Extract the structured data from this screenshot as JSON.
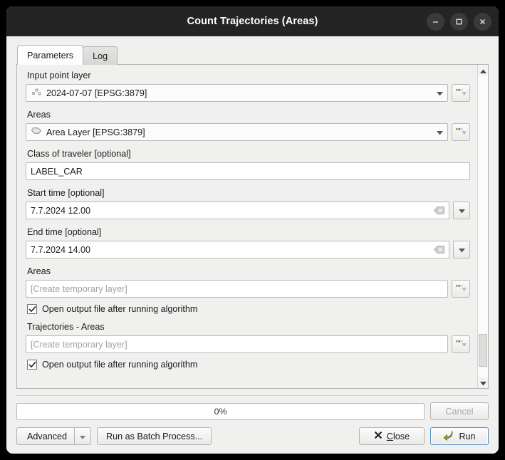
{
  "window": {
    "title": "Count Trajectories (Areas)",
    "controls": {
      "minimize": "minimize",
      "maximize": "maximize",
      "close": "close"
    }
  },
  "tabs": [
    {
      "label": "Parameters",
      "active": true
    },
    {
      "label": "Log",
      "active": false
    }
  ],
  "parameters": {
    "input_point_layer": {
      "label": "Input point layer",
      "value": "2024-07-07 [EPSG:3879]",
      "icon": "point-layer-icon",
      "browse_label": "..."
    },
    "areas_input": {
      "label": "Areas",
      "value": "Area Layer [EPSG:3879]",
      "icon": "polygon-layer-icon",
      "browse_label": "..."
    },
    "class_of_traveler": {
      "label": "Class of traveler [optional]",
      "value": "LABEL_CAR"
    },
    "start_time": {
      "label": "Start time [optional]",
      "value": "7.7.2024 12.00"
    },
    "end_time": {
      "label": "End time [optional]",
      "value": "7.7.2024 14.00"
    },
    "areas_output": {
      "label": "Areas",
      "placeholder": "[Create temporary layer]",
      "value": "",
      "browse_label": "...",
      "open_after_label": "Open output file after running algorithm",
      "open_after_checked": true
    },
    "trajectories_areas_output": {
      "label": "Trajectories - Areas",
      "placeholder": "[Create temporary layer]",
      "value": "",
      "browse_label": "...",
      "open_after_label": "Open output file after running algorithm",
      "open_after_checked": true
    }
  },
  "footer": {
    "progress_text": "0%",
    "progress_percent": 0,
    "cancel_label": "Cancel",
    "cancel_enabled": false,
    "advanced_label": "Advanced",
    "batch_label": "Run as Batch Process...",
    "close_label_pre": "",
    "close_mnemonic": "C",
    "close_label_post": "lose",
    "run_label": "Run"
  },
  "colors": {
    "titlebar": "#242424",
    "window_bg": "#f0f0ef",
    "accent_focus": "#4e8fc4",
    "run_icon": "#7a9a3a",
    "placeholder_text": "#a3a3a3"
  }
}
